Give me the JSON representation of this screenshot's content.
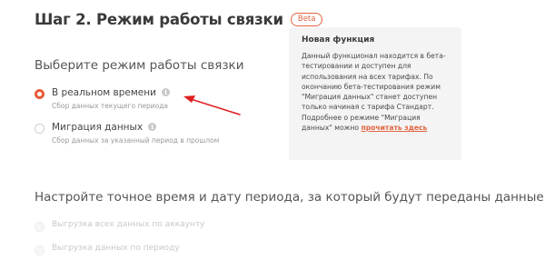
{
  "step": {
    "title": "Шаг 2. Режим работы связки",
    "badge": "Beta"
  },
  "mode": {
    "heading": "Выберите режим работы связки",
    "options": [
      {
        "label": "В реальном времени",
        "sub": "Сбор данных текущего периода",
        "selected": true
      },
      {
        "label": "Миграция данных",
        "sub": "Сбор данных за указанный период в прошлом",
        "selected": false
      }
    ]
  },
  "notice": {
    "title": "Новая функция",
    "text": "Данный функционал находится в бета-тестировании и доступен для использования на всех тарифах. По окончанию бета-тестирования режим \"Миграция данных\" станет доступен только начиная с тарифа Стандарт. Подробнее о режиме \"Миграция данных\" можно",
    "link": "прочитать здесь"
  },
  "period": {
    "heading": "Настройте точное время и дату периода, за который будут переданы данные",
    "options": [
      {
        "label": "Выгрузка всех данных по аккаунту"
      },
      {
        "label": "Выгрузка данных по периоду"
      }
    ]
  },
  "colors": {
    "accent": "#e85c38",
    "notice_bg": "#f4f4f4",
    "arrow": "#e02020"
  },
  "icons": {
    "info": "info-icon",
    "arrow": "arrow-icon"
  }
}
